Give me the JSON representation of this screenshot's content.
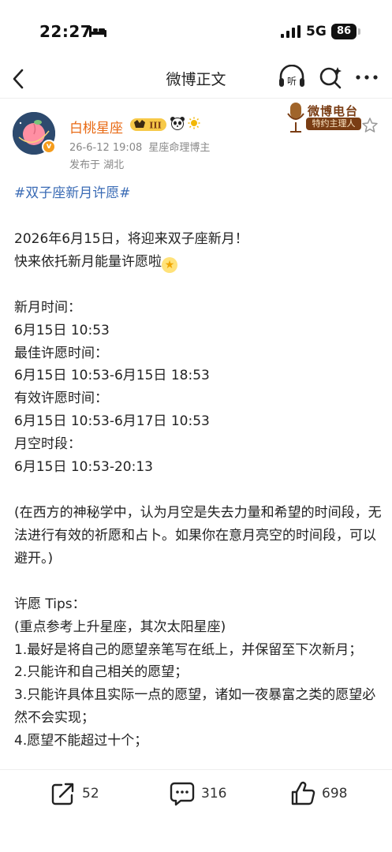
{
  "status_bar": {
    "time": "22:27",
    "network": "5G",
    "battery": "86"
  },
  "nav": {
    "title": "微博正文",
    "listen_label": "听"
  },
  "author": {
    "name": "白桃星座",
    "level": "III",
    "date": "26-6-12 19:08",
    "title": "星座命理博主",
    "location": "发布于 湖北"
  },
  "radio": {
    "title": "微博电台",
    "subtitle": "特约主理人"
  },
  "post": {
    "hashtag": "#双子座新月许愿#",
    "line1": "2026年6月15日，将迎来双子座新月！",
    "line2": "快来依托新月能量许愿啦",
    "new_moon_label": "新月时间：",
    "new_moon_time": "6月15日 10:53",
    "best_label": "最佳许愿时间：",
    "best_time": "6月15日 10:53-6月15日 18:53",
    "valid_label": "有效许愿时间：",
    "valid_time": "6月15日 10:53-6月17日 10:53",
    "void_label": "月空时段：",
    "void_time": "6月15日 10:53-20:13",
    "note": "(在西方的神秘学中，认为月空是失去力量和希望的时间段，无法进行有效的祈愿和占卜。如果你在意月亮空的时间段，可以避开。)",
    "tips_title": "许愿 Tips：",
    "tips_note": "(重点参考上升星座，其次太阳星座)",
    "tip1": "1.最好是将自己的愿望亲笔写在纸上，并保留至下次新月；",
    "tip2": "2.只能许和自己相关的愿望；",
    "tip3": "3.只能许具体且实际一点的愿望，诸如一夜暴富之类的愿望必然不会实现；",
    "tip4": "4.愿望不能超过十个；"
  },
  "actions": {
    "shares": "52",
    "comments": "316",
    "likes": "698"
  }
}
